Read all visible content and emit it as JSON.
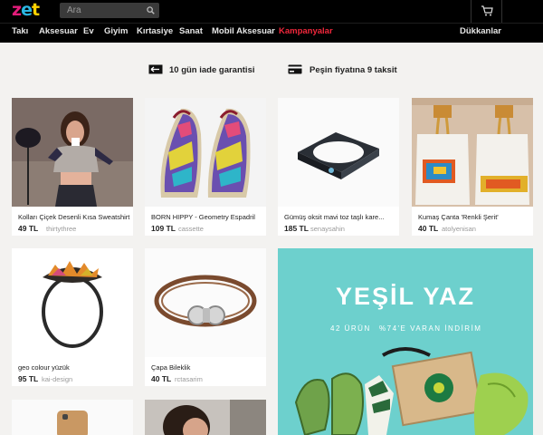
{
  "header": {
    "logo": {
      "z": "z",
      "e": "e",
      "t": "t"
    },
    "search": {
      "placeholder": "Ara"
    },
    "icons": {
      "search": "search-icon",
      "cart": "cart-icon"
    }
  },
  "nav": {
    "items": [
      "Takı",
      "Aksesuar",
      "Ev",
      "Giyim",
      "Kırtasiye",
      "Sanat",
      "Mobil Aksesuar"
    ],
    "promo": "Kampanyalar",
    "shops": "Dükkanlar"
  },
  "guarantees": [
    {
      "icon": "return-arrow-icon",
      "text": "10 gün iade garantisi"
    },
    {
      "icon": "credit-card-icon",
      "text": "Peşin fiyatına 9 taksit"
    }
  ],
  "products": [
    {
      "title": "Kolları Çiçek Desenli Kısa Sweatshirt",
      "price": "49 TL",
      "seller": "thirtythree"
    },
    {
      "title": "BORN HIPPY - Geometry Espadril",
      "price": "109 TL",
      "seller": "cassette"
    },
    {
      "title": "Gümüş oksit mavi toz taşlı kare...",
      "price": "185 TL",
      "seller": "senaysahin"
    },
    {
      "title": "Kumaş Çanta 'Renkli Şerit'",
      "price": "40 TL",
      "seller": "atolyenisan"
    },
    {
      "title": "geo colour yüzük",
      "price": "95 TL",
      "seller": "kai-design"
    },
    {
      "title": "Çapa Bileklik",
      "price": "40 TL",
      "seller": "rctasarim"
    }
  ],
  "banner": {
    "title": "YEŞİL YAZ",
    "count": "42 ÜRÜN",
    "discount": "%74'E VARAN İNDİRİM"
  },
  "colors": {
    "accent_pink": "#e41d7b",
    "accent_blue": "#2bb6e3",
    "accent_yellow": "#ffd200",
    "promo_red": "#f0273b",
    "banner_teal": "#6dd0cd"
  }
}
